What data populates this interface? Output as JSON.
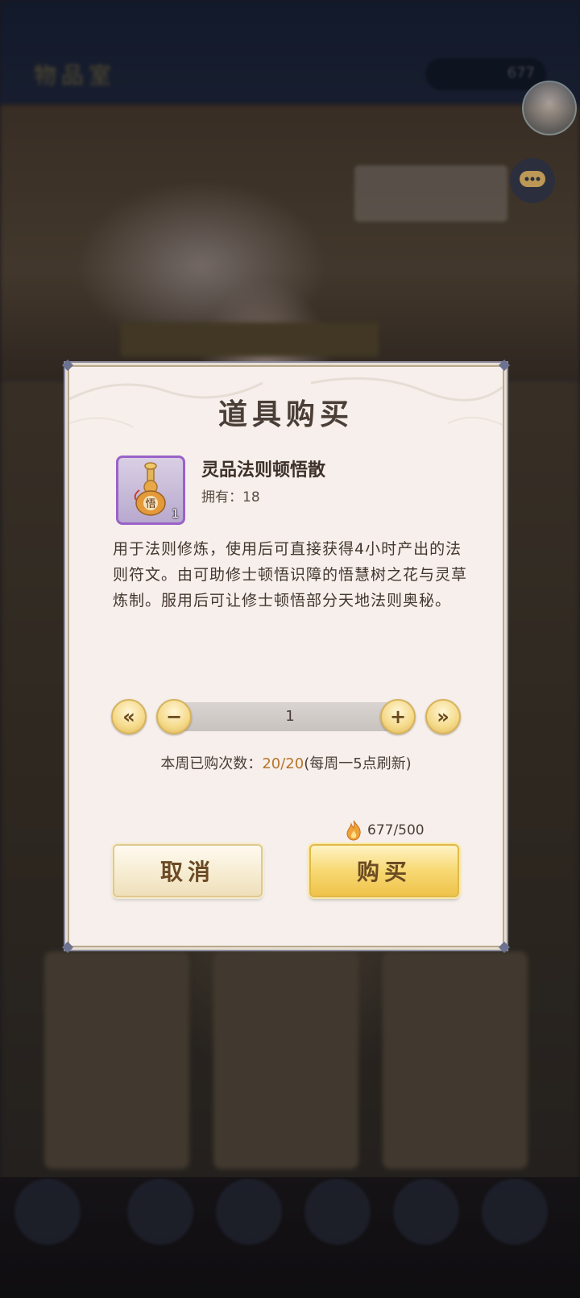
{
  "background": {
    "shop_title": "物品室",
    "currency_value": "677"
  },
  "dialog": {
    "title": "道具购买",
    "item": {
      "name": "灵品法则顿悟散",
      "owned_label": "拥有：",
      "owned_value": "18",
      "icon_count": "1",
      "icon_glyph": "悟"
    },
    "description": "用于法则修炼，使用后可直接获得4小时产出的法则符文。由可助修士顿悟识障的悟慧树之花与灵草炼制。服用后可让修士顿悟部分天地法则奥秘。",
    "stepper": {
      "min_symbol": "«",
      "minus_symbol": "−",
      "value": "1",
      "plus_symbol": "+",
      "max_symbol": "»"
    },
    "weekly_limit": {
      "label": "本周已购次数：",
      "value": "20/20",
      "note": "(每周一5点刷新)"
    },
    "cost": {
      "value": "677/500"
    },
    "buttons": {
      "cancel": "取消",
      "buy": "购买"
    }
  },
  "colors": {
    "accent_gold": "#efc34b",
    "highlight_text": "#b7762b",
    "item_border": "#9a62c8"
  }
}
